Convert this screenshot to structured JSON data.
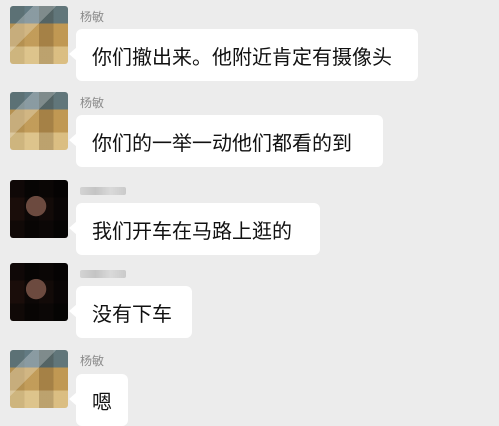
{
  "messages": [
    {
      "sender_name": "杨敏",
      "sender_visible": true,
      "avatar_type": "blurred-light-avatar",
      "text": "你们撤出来。他附近肯定有摄像头"
    },
    {
      "sender_name": "杨敏",
      "sender_visible": true,
      "avatar_type": "blurred-light-avatar",
      "text": "你们的一举一动他们都看的到"
    },
    {
      "sender_name": "",
      "sender_visible": false,
      "avatar_type": "blurred-dark-avatar",
      "text": "我们开车在马路上逛的"
    },
    {
      "sender_name": "",
      "sender_visible": false,
      "avatar_type": "blurred-dark-avatar",
      "text": "没有下车"
    },
    {
      "sender_name": "杨敏",
      "sender_visible": true,
      "avatar_type": "blurred-light-avatar",
      "text": "嗯"
    }
  ]
}
